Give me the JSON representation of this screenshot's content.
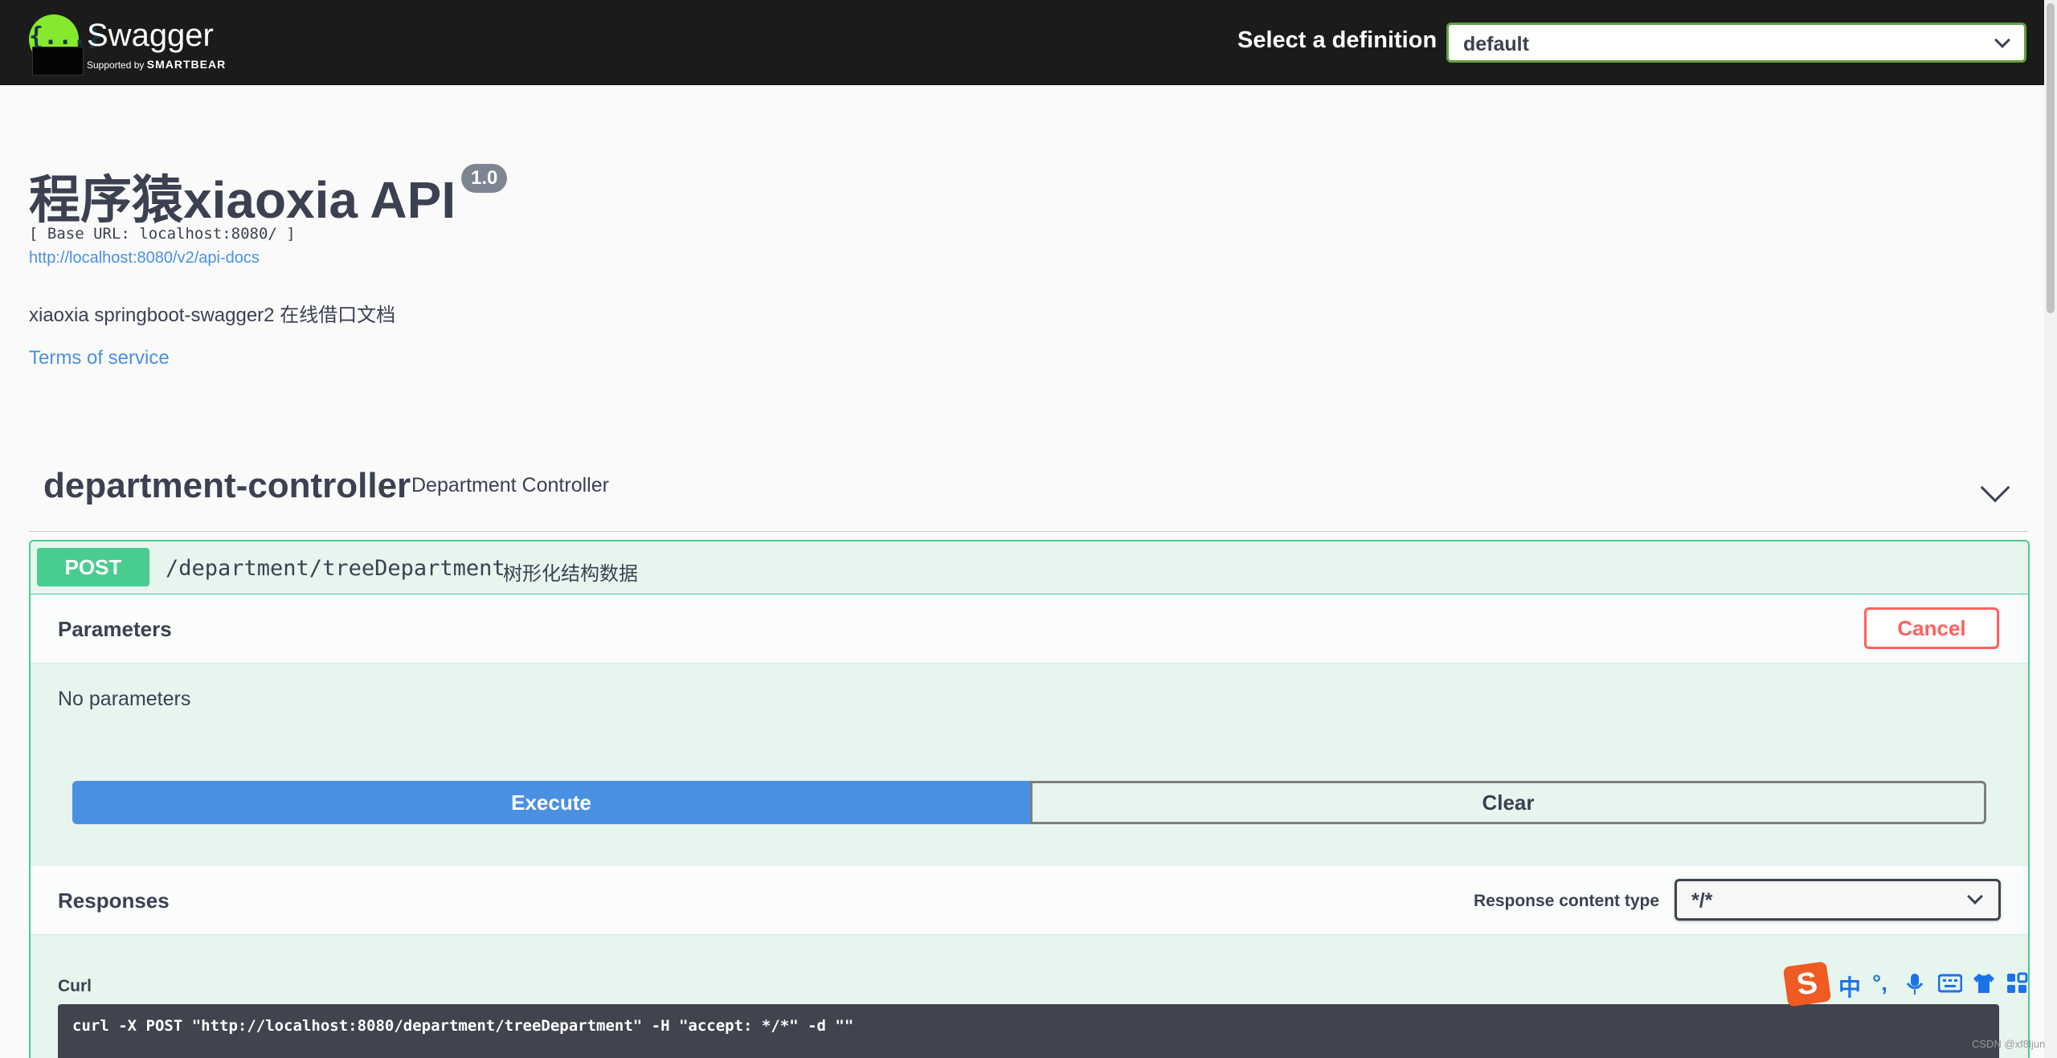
{
  "topbar": {
    "logo_text": "Swagger",
    "logo_sub_prefix": "Supported by",
    "logo_sub_brand": "SMARTBEAR",
    "definition_label": "Select a definition",
    "definition_value": "default"
  },
  "info": {
    "title": "程序猿xiaoxia API",
    "version": "1.0",
    "base_url": "[ Base URL: localhost:8080/ ]",
    "docs_url": "http://localhost:8080/v2/api-docs",
    "description": "xiaoxia springboot-swagger2 在线借口文档",
    "terms_link": "Terms of service"
  },
  "tag": {
    "name": "department-controller",
    "description": "Department Controller"
  },
  "operation": {
    "method": "POST",
    "path": "/department/treeDepartment",
    "summary": "树形化结构数据",
    "parameters_label": "Parameters",
    "cancel_label": "Cancel",
    "no_params": "No parameters",
    "execute_label": "Execute",
    "clear_label": "Clear",
    "responses_label": "Responses",
    "response_content_type_label": "Response content type",
    "response_content_type_value": "*/*",
    "curl_label": "Curl",
    "curl_command": "curl -X POST \"http://localhost:8080/department/treeDepartment\" -H \"accept: */*\" -d \"\""
  },
  "ime_toolbar": {
    "logo": "S",
    "items": [
      "中",
      "°,",
      "mic-icon",
      "keyboard-icon",
      "shirt-icon",
      "grid-icon"
    ]
  },
  "watermark": "CSDN @xf8ljun",
  "colors": {
    "post": "#49cc90",
    "execute": "#4990e2",
    "cancel": "#ff6060",
    "link": "#4990e2",
    "topbar": "#1b1b1b"
  }
}
